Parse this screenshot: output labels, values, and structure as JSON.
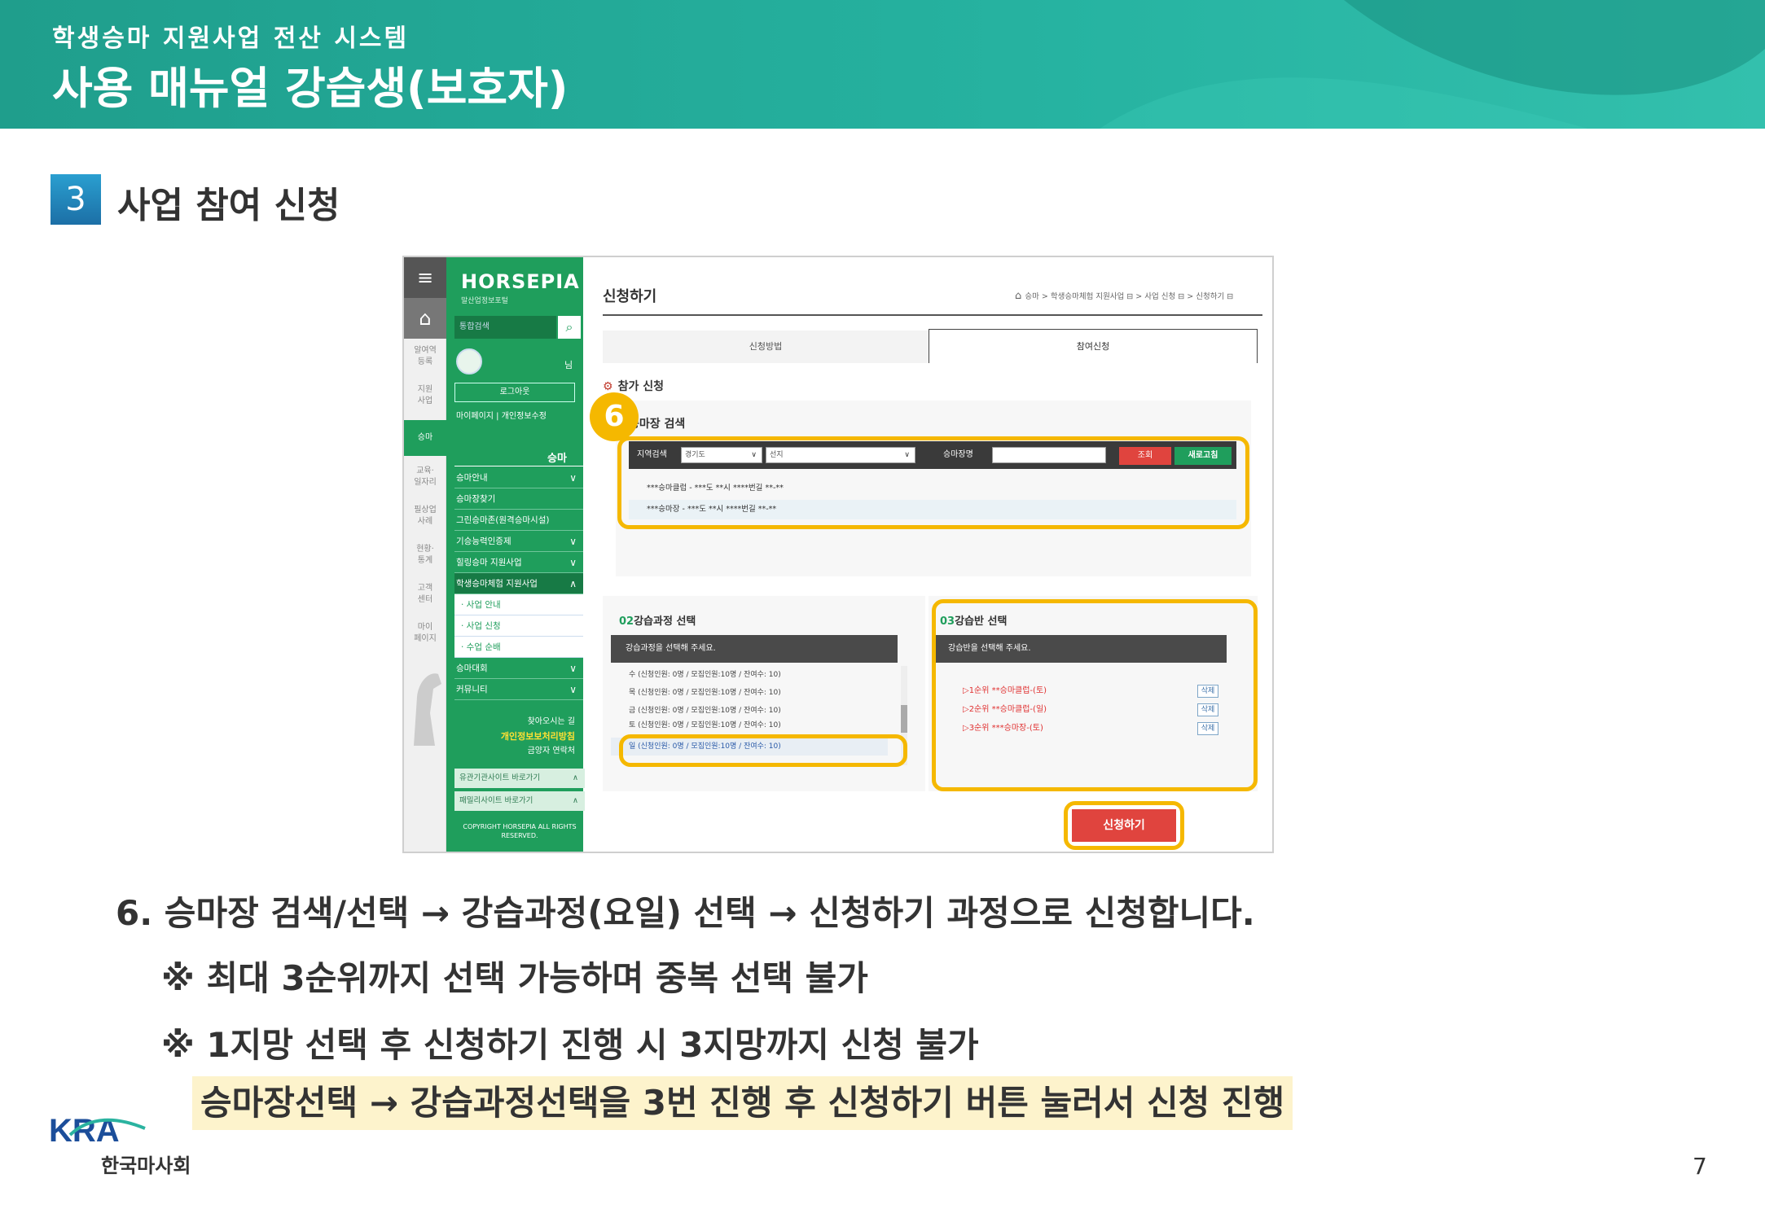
{
  "header": {
    "subtitle": "학생승마 지원사업 전산 시스템",
    "title": "사용 매뉴얼 강습생(보호자)"
  },
  "section": {
    "number": "3",
    "title": "사업 참여 신청"
  },
  "colors": {
    "banner": "#26b3a1",
    "highlight": "#f5b800",
    "brand_green": "#1f9e5c",
    "apply_red": "#e0443e"
  },
  "screenshot": {
    "rail": {
      "items": [
        "알여역\n등록",
        "지원\n사업",
        "승마",
        "교육·\n일자리",
        "필상업\n사례",
        "현황·\n통계",
        "고객\n센터",
        "마이\n페이지"
      ]
    },
    "nav": {
      "logo": "HORSEPIA",
      "logo_sub": "말산업정보포털",
      "search": "통합검색",
      "nim": "님",
      "logout": "로그아웃",
      "mylinks": "마이페이지 | 개인정보수정",
      "section": "승마",
      "menu": [
        {
          "label": "승마안내",
          "chev": "∨",
          "type": "normal"
        },
        {
          "label": "승마장찾기",
          "chev": "",
          "type": "normal"
        },
        {
          "label": "그린승마존(원격승마시설)",
          "chev": "",
          "type": "normal"
        },
        {
          "label": "기승능력인증제",
          "chev": "∨",
          "type": "normal"
        },
        {
          "label": "힐링승마 지원사업",
          "chev": "∨",
          "type": "normal"
        },
        {
          "label": "학생승마체험 지원사업",
          "chev": "∧",
          "type": "active"
        },
        {
          "label": "· 사업 안내",
          "chev": "",
          "type": "sub"
        },
        {
          "label": "· 사업 신청",
          "chev": "",
          "type": "sub"
        },
        {
          "label": "· 수업 순배",
          "chev": "",
          "type": "sub"
        },
        {
          "label": "승마대회",
          "chev": "∨",
          "type": "normal"
        },
        {
          "label": "커뮤니티",
          "chev": "∨",
          "type": "normal"
        }
      ],
      "privacy_l1": "찾아오시는 길",
      "privacy_l2": "개인정보보처리방침",
      "privacy_l3": "금양자 연락처",
      "footer_btn1": "유관기관사이트 바로가기",
      "footer_btn2": "패밀리사이트 바로가기",
      "copyright": "COPYRIGHT HORSEPIA ALL RIGHTS RESERVED."
    },
    "main": {
      "page_title": "신청하기",
      "breadcrumb": "승마 > 학생승마체험 지원사업 ⊟ > 사업 신청 ⊟ > 신청하기 ⊟",
      "tabs": [
        "신청방법",
        "참여신청"
      ],
      "section_heading": "참가 신청",
      "search": {
        "heading": "승마장 검색",
        "region_label": "지역검색",
        "region_value": "경기도",
        "city_value": "선지",
        "name_label": "승마장명",
        "search_btn": "조회",
        "reset_btn": "새로고침",
        "results": [
          "***승마클럽 - ***도 **시 ****번길 **-**",
          "***승마장 - ***도 **시 ****번길 **-**"
        ]
      },
      "course": {
        "num": "02",
        "heading": "강습과정 선택",
        "placeholder": "강습과정을 선택해 주세요.",
        "rows": [
          "수 (신청인원: 0명 / 모집인원:10명 / 잔여수: 10)",
          "목 (신청인원: 0명 / 모집인원:10명 / 잔여수: 10)",
          "금 (신청인원: 0명 / 모집인원:10명 / 잔여수: 10)",
          "토 (신청인원: 0명 / 모집인원:10명 / 잔여수: 10)",
          "일 (신청인원: 0명 / 모집인원:10명 / 잔여수: 10)"
        ]
      },
      "class": {
        "num": "03",
        "heading": "강습반 선택",
        "placeholder": "강습반을 선택해 주세요.",
        "rows": [
          {
            "label": "▷1순위 **승마클럽-(토)",
            "del": "삭제"
          },
          {
            "label": "▷2순위 **승마클럽-(일)",
            "del": "삭제"
          },
          {
            "label": "▷3순위 ***승마장-(토)",
            "del": "삭제"
          }
        ]
      },
      "apply_btn": "신청하기",
      "callout": "6"
    }
  },
  "body": {
    "step": "6. 승마장 검색/선택 → 강습과정(요일) 선택 → 신청하기 과정으로 신청합니다.",
    "note1": "※ 최대 3순위까지 선택 가능하며 중복 선택 불가",
    "note2": "※ 1지망 선택 후 신청하기 진행 시 3지망까지 신청 불가",
    "highlight": "승마장선택 → 강습과정선택을 3번 진행 후 신청하기 버튼 눌러서 신청 진행"
  },
  "footer": {
    "logo": "KRA",
    "org": "한국마사회",
    "page": "7"
  }
}
